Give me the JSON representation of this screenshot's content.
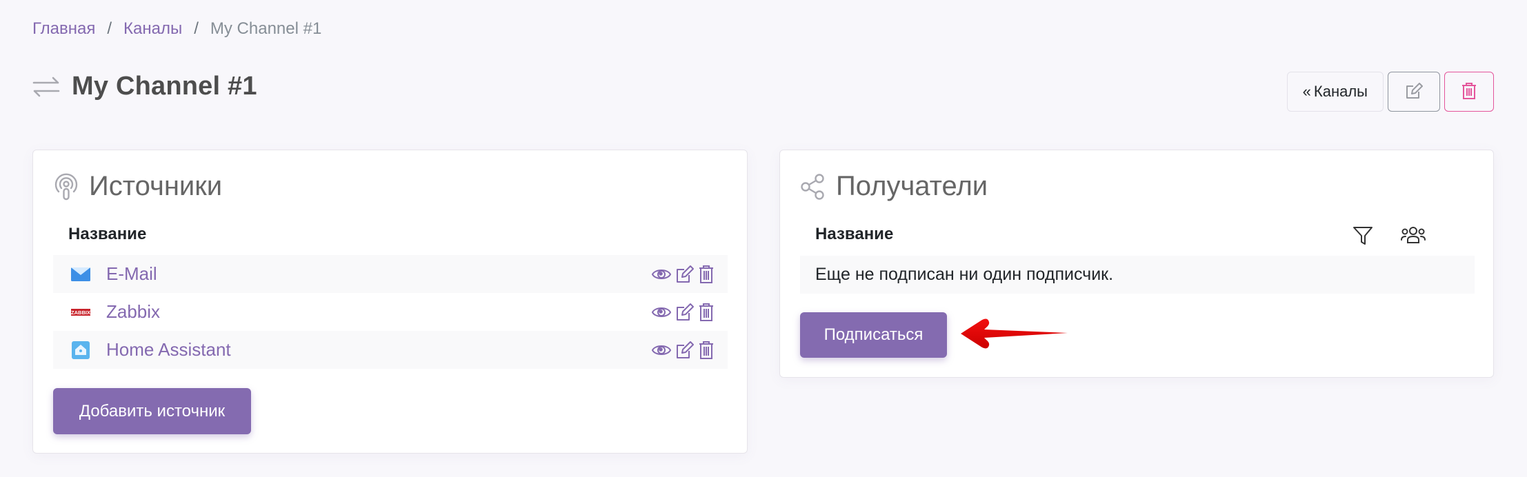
{
  "breadcrumb": {
    "items": [
      {
        "label": "Главная",
        "link": true
      },
      {
        "label": "Каналы",
        "link": true
      },
      {
        "label": "My Channel #1",
        "link": false
      }
    ],
    "separator": "/"
  },
  "header": {
    "icon": "exchange-arrows-icon",
    "title": "My Channel #1",
    "actions": {
      "back_chevron": "«",
      "back_label": "Каналы",
      "edit_icon": "edit-icon",
      "delete_icon": "trash-icon"
    }
  },
  "sources": {
    "icon": "podcast-icon",
    "title": "Источники",
    "column_header": "Название",
    "items": [
      {
        "name": "E-Mail",
        "icon": "email-envelope-icon"
      },
      {
        "name": "Zabbix",
        "icon": "zabbix-logo-icon"
      },
      {
        "name": "Home Assistant",
        "icon": "home-assistant-icon"
      }
    ],
    "row_actions": [
      "eye-icon",
      "edit-icon",
      "trash-icon"
    ],
    "add_button": "Добавить источник"
  },
  "recipients": {
    "icon": "share-icon",
    "title": "Получатели",
    "column_header": "Название",
    "tools": [
      "filter-icon",
      "users-group-icon"
    ],
    "empty_message": "Еще не подписан ни один подписчик.",
    "subscribe_button": "Подписаться"
  },
  "annotation": {
    "type": "red-arrow",
    "points_to": "subscribe-button"
  },
  "colors": {
    "accent": "#846bb0",
    "link": "#8469b0",
    "danger": "#e4559b",
    "annotation": "#e00000",
    "background": "#f8f7fb"
  }
}
